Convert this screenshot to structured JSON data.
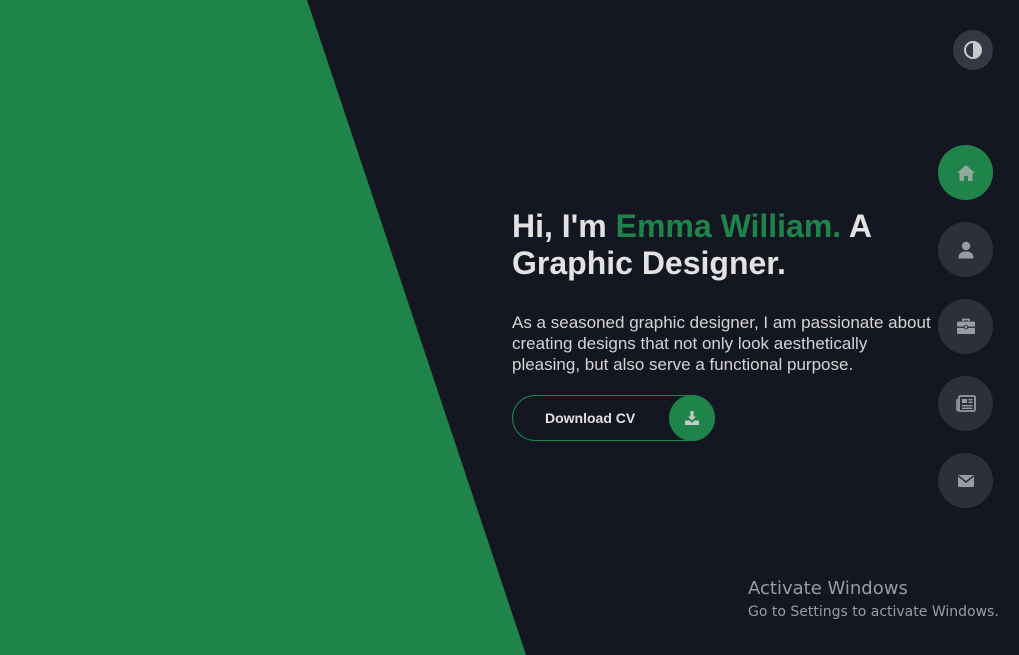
{
  "colors": {
    "background": "#141722",
    "accent_green": "#1f844a",
    "nav_button": "#2c3039",
    "text_light": "#e2e2e2"
  },
  "theme_toggle": {
    "icon": "contrast-icon"
  },
  "nav": {
    "items": [
      {
        "icon": "home-icon",
        "active": true
      },
      {
        "icon": "user-icon",
        "active": false
      },
      {
        "icon": "briefcase-icon",
        "active": false
      },
      {
        "icon": "newspaper-icon",
        "active": false
      },
      {
        "icon": "envelope-icon",
        "active": false
      }
    ]
  },
  "hero": {
    "greeting": "Hi, I'm ",
    "name": "Emma William.",
    "role_line1": " A",
    "role_line2": "Graphic Designer.",
    "bio": "As a seasoned graphic designer, I am passionate about creating designs that not only look aesthetically pleasing, but also serve a functional purpose.",
    "cv_button_label": "Download CV",
    "cv_button_icon": "download-icon"
  },
  "watermark": {
    "title": "Activate Windows",
    "subtitle": "Go to Settings to activate Windows."
  }
}
